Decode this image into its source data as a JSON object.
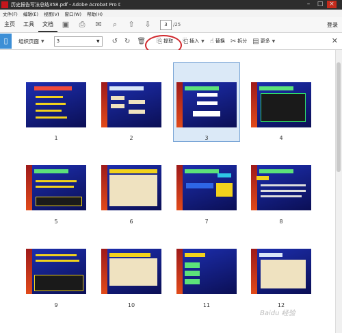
{
  "window": {
    "title": "历史报告写法总结358.pdf - Adobe Acrobat Pro DC"
  },
  "menu": [
    "文件(F)",
    "编辑(E)",
    "视图(V)",
    "窗口(W)",
    "帮助(H)"
  ],
  "tabs": [
    "主页",
    "工具",
    "文档"
  ],
  "nav": {
    "page_value": "3",
    "page_total": "/25"
  },
  "login": "登录",
  "toolbar": {
    "organize_label": "组织页面",
    "page_select_value": "3",
    "extract_label": "提取",
    "insert_label": "插入",
    "replace_label": "替换",
    "split_label": "拆分",
    "more_label": "更多"
  },
  "pages": [
    "1",
    "2",
    "3",
    "4",
    "5",
    "6",
    "7",
    "8",
    "9",
    "10",
    "11",
    "12"
  ],
  "selected_page": "3",
  "watermark": "Baidu 经验"
}
